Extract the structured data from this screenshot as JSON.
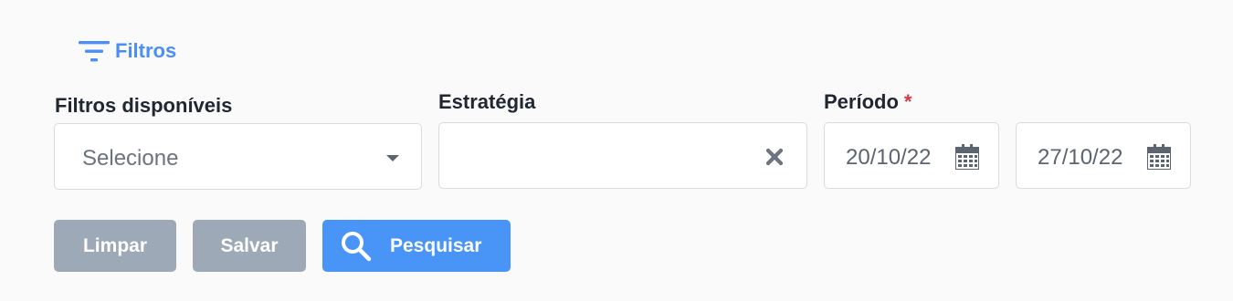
{
  "filters_toggle": {
    "label": "Filtros",
    "icon": "filter-lines-icon"
  },
  "fields": {
    "available_filters": {
      "label": "Filtros disponíveis",
      "placeholder": "Selecione"
    },
    "strategy": {
      "label": "Estratégia",
      "value": ""
    },
    "period": {
      "label": "Período",
      "required_mark": "*",
      "start_date": "20/10/22",
      "end_date": "27/10/22"
    }
  },
  "buttons": {
    "clear": "Limpar",
    "save": "Salvar",
    "search": "Pesquisar"
  },
  "colors": {
    "accent": "#4895f7",
    "link": "#4b8ef5",
    "secondary_button": "#9ea9b8",
    "required": "#d9363e"
  }
}
